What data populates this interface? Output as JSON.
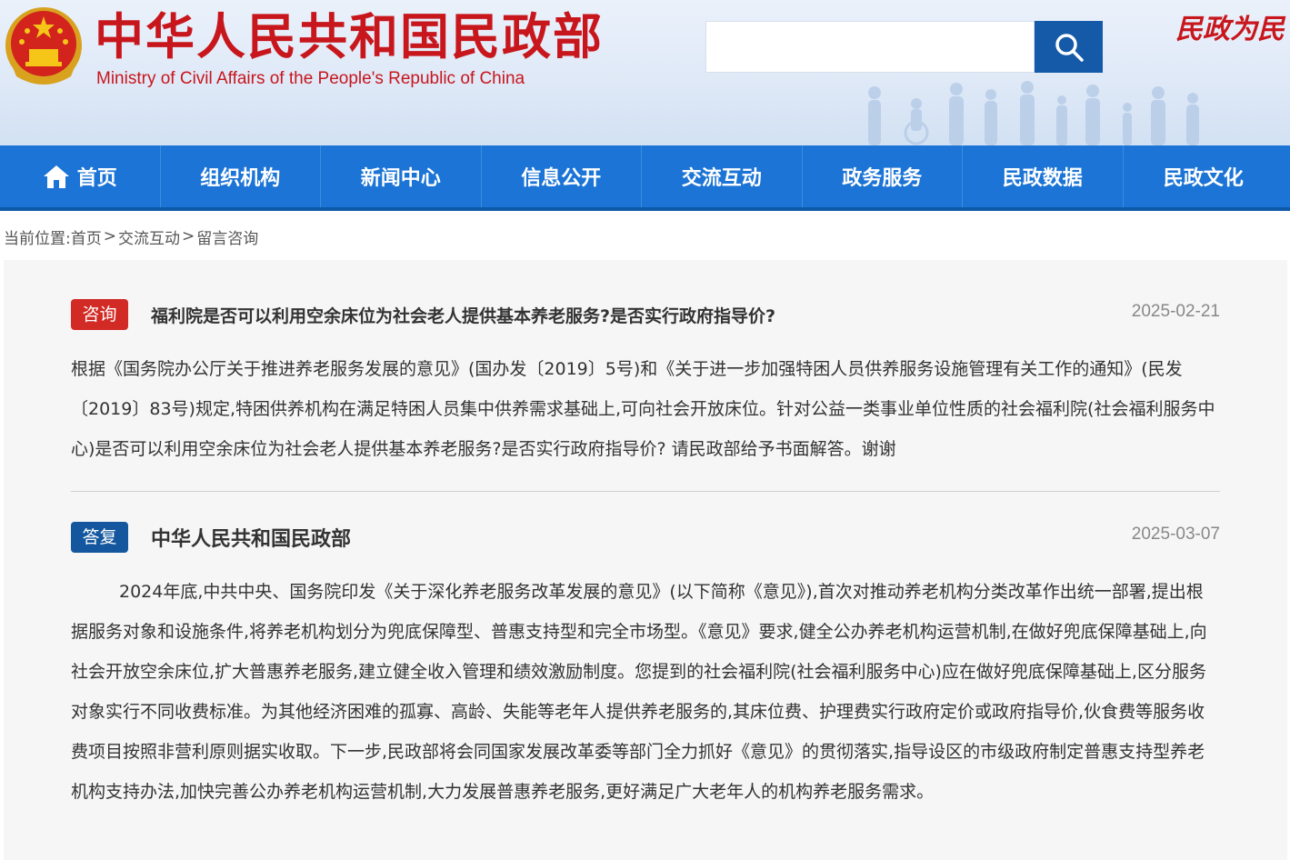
{
  "header": {
    "title": "中华人民共和国民政部",
    "subtitle": "Ministry of Civil Affairs of the People's Republic of China",
    "slogan": "民政为民",
    "search": {
      "placeholder": "",
      "value": ""
    }
  },
  "nav": {
    "items": [
      {
        "label": "首页"
      },
      {
        "label": "组织机构"
      },
      {
        "label": "新闻中心"
      },
      {
        "label": "信息公开"
      },
      {
        "label": "交流互动"
      },
      {
        "label": "政务服务"
      },
      {
        "label": "民政数据"
      },
      {
        "label": "民政文化"
      }
    ]
  },
  "breadcrumb": {
    "prefix": "当前位置:",
    "items": [
      "首页",
      "交流互动",
      "留言咨询"
    ],
    "separator": ">"
  },
  "question": {
    "badge": "咨询",
    "title": "福利院是否可以利用空余床位为社会老人提供基本养老服务?是否实行政府指导价?",
    "date": "2025-02-21",
    "body": "根据《国务院办公厅关于推进养老服务发展的意见》(国办发〔2019〕5号)和《关于进一步加强特困人员供养服务设施管理有关工作的通知》(民发〔2019〕83号)规定,特困供养机构在满足特困人员集中供养需求基础上,可向社会开放床位。针对公益一类事业单位性质的社会福利院(社会福利服务中心)是否可以利用空余床位为社会老人提供基本养老服务?是否实行政府指导价? 请民政部给予书面解答。谢谢"
  },
  "answer": {
    "badge": "答复",
    "title": "中华人民共和国民政部",
    "date": "2025-03-07",
    "body": "2024年底,中共中央、国务院印发《关于深化养老服务改革发展的意见》(以下简称《意见》),首次对推动养老机构分类改革作出统一部署,提出根据服务对象和设施条件,将养老机构划分为兜底保障型、普惠支持型和完全市场型。《意见》要求,健全公办养老机构运营机制,在做好兜底保障基础上,向社会开放空余床位,扩大普惠养老服务,建立健全收入管理和绩效激励制度。您提到的社会福利院(社会福利服务中心)应在做好兜底保障基础上,区分服务对象实行不同收费标准。为其他经济困难的孤寡、高龄、失能等老年人提供养老服务的,其床位费、护理费实行政府定价或政府指导价,伙食费等服务收费项目按照非营利原则据实收取。下一步,民政部将会同国家发展改革委等部门全力抓好《意见》的贯彻落实,指导设区的市级政府制定普惠支持型养老机构支持办法,加快完善公办养老机构运营机制,大力发展普惠养老服务,更好满足广大老年人的机构养老服务需求。"
  },
  "colors": {
    "brand_red": "#c8161d",
    "nav_blue": "#1b74d6",
    "search_blue": "#155aa8",
    "badge_red": "#d22a24",
    "badge_blue": "#14579e"
  },
  "icons": [
    "national-emblem-icon",
    "search-icon",
    "home-icon"
  ]
}
